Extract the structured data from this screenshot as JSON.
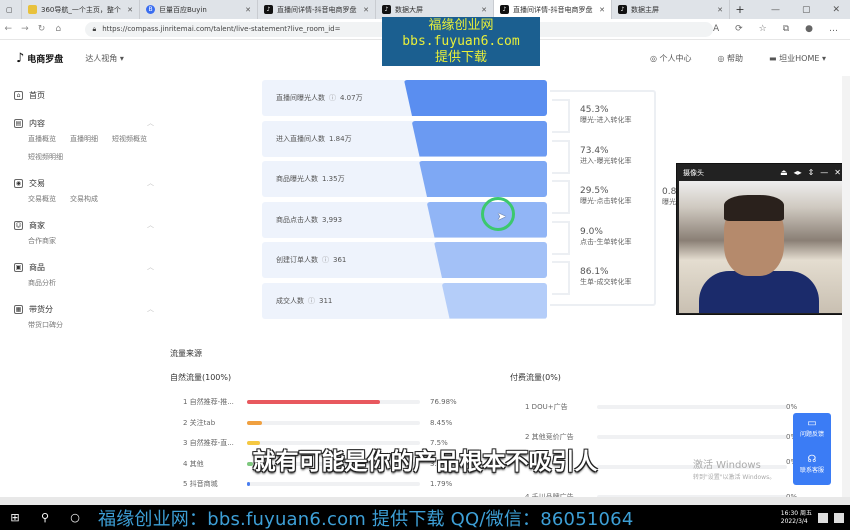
{
  "browser": {
    "tabs": [
      {
        "title": "360导航_一个主页，整个",
        "active": false
      },
      {
        "title": "巨量百应Buyin",
        "active": false
      },
      {
        "title": "直播间详情-抖音电商罗盘",
        "active": false
      },
      {
        "title": "数据大屏",
        "active": false
      },
      {
        "title": "直播间详情-抖音电商罗盘",
        "active": true
      },
      {
        "title": "数据主屏",
        "active": false
      }
    ],
    "url": "https://compass.jinritemai.com/talent/live-statement?live_room_id="
  },
  "watermark": {
    "line1": "福缘创业网",
    "line2": "bbs.fuyuan6.com",
    "line3": "提供下载"
  },
  "header": {
    "logo": "电商罗盘",
    "perspective": "达人视角",
    "personal": "个人中心",
    "help": "帮助",
    "account": "坦业HOME"
  },
  "sidebar": [
    {
      "label": "首页",
      "icon": "home-icon",
      "items": []
    },
    {
      "label": "内容",
      "icon": "content-icon",
      "items": [
        "直播概览",
        "直播明细",
        "短视频概览",
        "短视频明细"
      ]
    },
    {
      "label": "交易",
      "icon": "trade-icon",
      "items": [
        "交易概览",
        "交易构成"
      ]
    },
    {
      "label": "商家",
      "icon": "merchant-icon",
      "items": [
        "合作商家"
      ]
    },
    {
      "label": "商品",
      "icon": "product-icon",
      "items": [
        "商品分析"
      ]
    },
    {
      "label": "带货分",
      "icon": "score-icon",
      "items": [
        "带货口碑分"
      ]
    }
  ],
  "funnel": [
    {
      "label": "直播间曝光人数",
      "value": "4.07万",
      "info": true
    },
    {
      "label": "进入直播间人数",
      "value": "1.84万",
      "info": false
    },
    {
      "label": "商品曝光人数",
      "value": "1.35万",
      "info": false
    },
    {
      "label": "商品点击人数",
      "value": "3,993",
      "info": false
    },
    {
      "label": "创建订单人数",
      "value": "361",
      "info": true
    },
    {
      "label": "成交人数",
      "value": "311",
      "info": true
    }
  ],
  "rates": [
    {
      "value": "45.3%",
      "name": "曝光-进入转化率"
    },
    {
      "value": "73.4%",
      "name": "进入-曝光转化率"
    },
    {
      "value": "29.5%",
      "name": "曝光-点击转化率"
    },
    {
      "value": "9.0%",
      "name": "点击-生单转化率"
    },
    {
      "value": "86.1%",
      "name": "生单-成交转化率"
    }
  ],
  "overall_rate": {
    "value": "0.8",
    "name": "曝光"
  },
  "camera": {
    "title": "摄像头"
  },
  "traffic": {
    "title": "流量来源",
    "natural": {
      "title": "自然流量(100%)",
      "items": [
        {
          "name": "1 自然推荐-推...",
          "pct": "76.98%",
          "value": 76.98,
          "color": "#e8585e"
        },
        {
          "name": "2 关注tab",
          "pct": "8.45%",
          "value": 8.45,
          "color": "#f0a040"
        },
        {
          "name": "3 自然推荐-直...",
          "pct": "7.5%",
          "value": 7.5,
          "color": "#f5c842"
        },
        {
          "name": "4 其他",
          "pct": "3.2",
          "value": 3.2,
          "color": "#7ec87e"
        },
        {
          "name": "5 抖音商城",
          "pct": "1.79%",
          "value": 1.79,
          "color": "#4a7ef0"
        }
      ]
    },
    "paid": {
      "title": "付费流量(0%)",
      "items": [
        {
          "name": "1 DOU+广告",
          "pct": "0%"
        },
        {
          "name": "2 其他竞价广告",
          "pct": "0%"
        },
        {
          "name": "",
          "pct": "0%"
        },
        {
          "name": "4 千川品牌广告",
          "pct": "0%"
        }
      ]
    }
  },
  "float": {
    "feedback": "问题反馈",
    "service": "联系客服"
  },
  "activate": {
    "line1": "激活 Windows",
    "line2": "转到\"设置\"以激活 Windows。"
  },
  "subtitle": "就有可能是你的产品根本不吸引人",
  "taskbar": {
    "banner": "福缘创业网：bbs.fuyuan6.com  提供下载   QQ/微信：86051064",
    "time": "16:30 周五",
    "date": "2022/3/4"
  }
}
